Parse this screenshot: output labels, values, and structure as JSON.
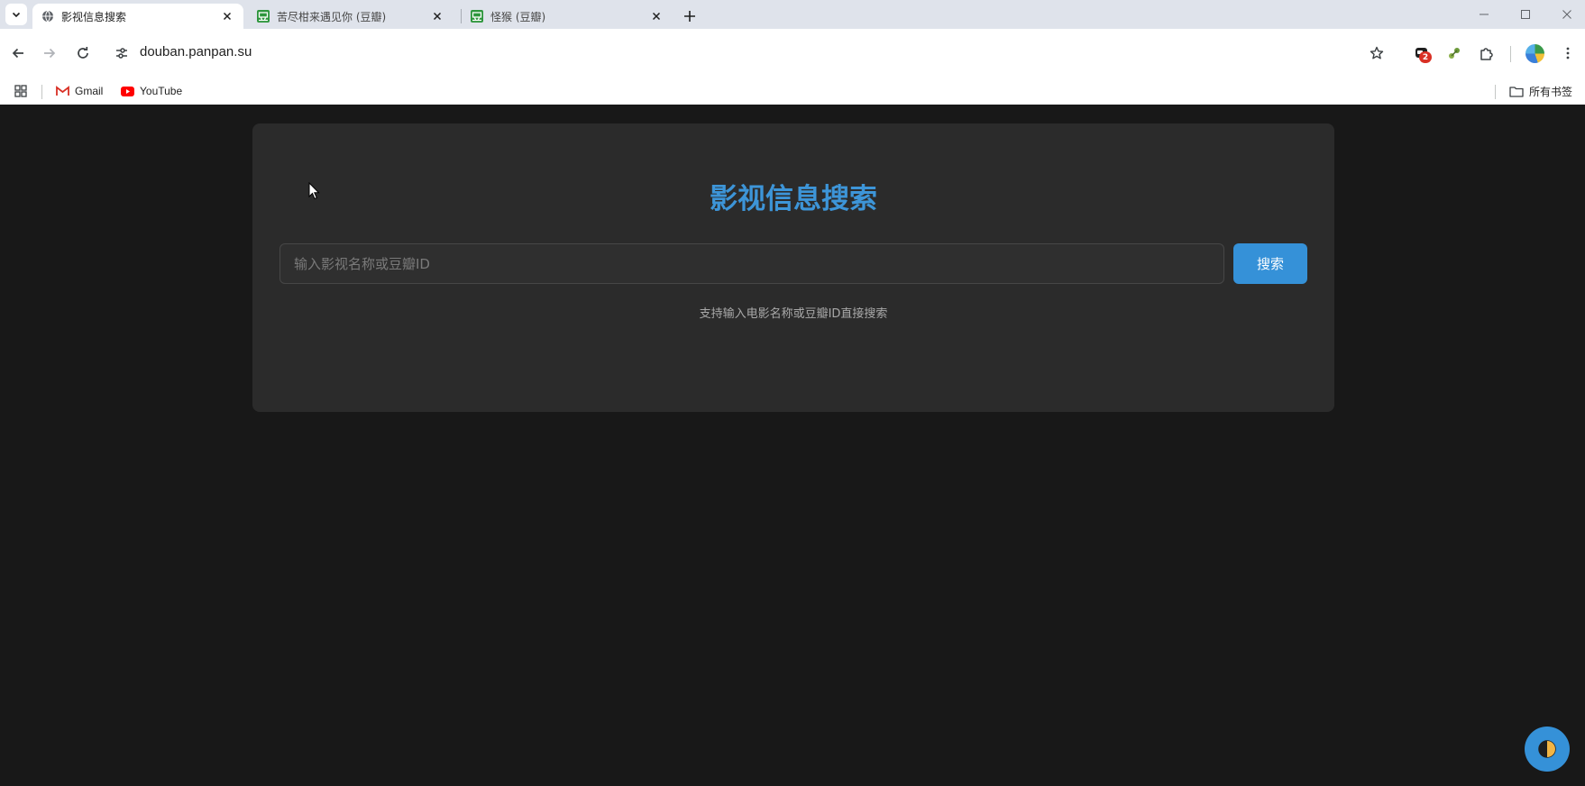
{
  "browser": {
    "tabs": [
      {
        "title": "影视信息搜索",
        "active": true,
        "icon": "globe-icon"
      },
      {
        "title": "苦尽柑来遇见你 (豆瓣)",
        "active": false,
        "icon": "douban-icon"
      },
      {
        "title": "怪猴 (豆瓣)",
        "active": false,
        "icon": "douban-icon"
      }
    ],
    "url": "douban.panpan.su",
    "extension_badge": "2",
    "bookmarks": [
      {
        "label": "Gmail",
        "icon": "gmail-icon"
      },
      {
        "label": "YouTube",
        "icon": "youtube-icon"
      }
    ],
    "all_bookmarks_label": "所有书签"
  },
  "page": {
    "title": "影视信息搜索",
    "search_placeholder": "输入影视名称或豆瓣ID",
    "search_value": "",
    "search_button": "搜索",
    "hint": "支持输入电影名称或豆瓣ID直接搜索"
  },
  "colors": {
    "page_background": "#181818",
    "card_background": "#2b2b2b",
    "accent": "#3591d8",
    "title": "#3d95d8"
  }
}
